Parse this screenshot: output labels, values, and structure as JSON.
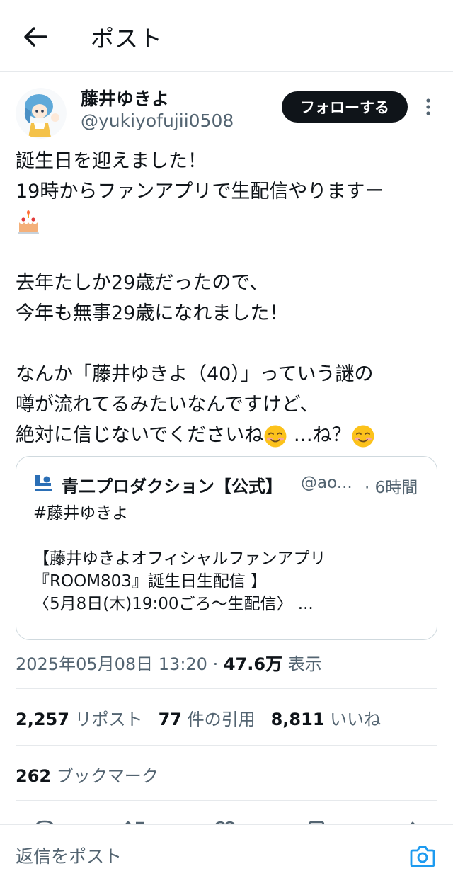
{
  "header": {
    "title": "ポスト"
  },
  "author": {
    "name": "藤井ゆきよ",
    "handle": "@yukiyofujii0508",
    "follow_label": "フォローする"
  },
  "tweet": {
    "lines": [
      "誕生日を迎えました！",
      "19時からファンアプリで生配信やりますー"
    ],
    "paragraph2": [
      "去年たしか29歳だったので、",
      "今年も無事29歳になれました！"
    ],
    "paragraph3": [
      "なんか「藤井ゆきよ（40）」っていう謎の",
      "噂が流れてるみたいなんですけど、"
    ],
    "last_line_prefix": "絶対に信じないでくださいね",
    "last_line_middle": " …ね？",
    "emoji_cake": "birthday-cake-icon",
    "emoji_smile": "smiling-face-icon"
  },
  "quote": {
    "name": "青二プロダクション【公式】",
    "handle": "@ao...",
    "time": "· 6時間",
    "logo_label": "AONI PRO",
    "lines": [
      "#藤井ゆきよ",
      "",
      "【藤井ゆきよオフィシャルファンアプリ",
      "『ROOM803』誕生日生配信 】",
      "〈5月8日(木)19:00ごろ～生配信〉 ..."
    ]
  },
  "meta": {
    "datetime": "2025年05月08日 13:20 · ",
    "views": "47.6万",
    "views_label": " 表示"
  },
  "stats": {
    "reposts": "2,257",
    "reposts_label": "リポスト",
    "quotes": "77",
    "quotes_label": "件の引用",
    "likes": "8,811",
    "likes_label": "いいね"
  },
  "bookmarks": {
    "count": "262",
    "label": "ブックマーク"
  },
  "reply": {
    "placeholder": "返信をポスト"
  },
  "colors": {
    "text": "#0f1419",
    "secondary": "#536471",
    "border": "#cfd9de",
    "accent": "#1d9bf0",
    "follow_bg": "#0f1419",
    "logo_blue": "#2b6fb6"
  }
}
